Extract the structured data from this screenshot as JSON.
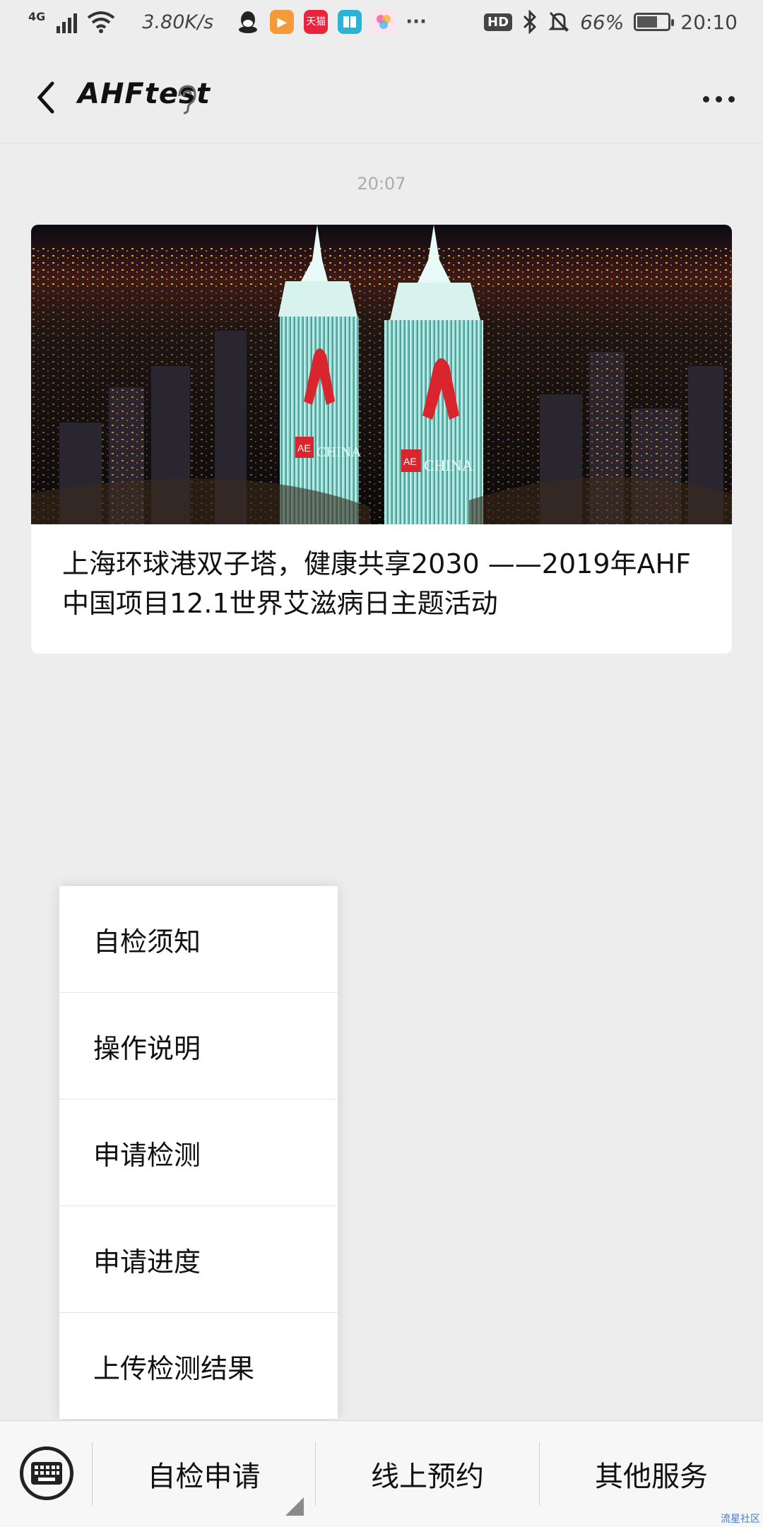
{
  "status_bar": {
    "network_type": "4G",
    "speed": "3.80K/s",
    "more_indicator": "···",
    "hd_label": "HD",
    "battery_percent": "66%",
    "battery_level": 0.66,
    "time": "20:10",
    "app_icons": [
      {
        "name": "qq-icon",
        "color": "#222222"
      },
      {
        "name": "video-app-icon",
        "color": "#f29b38"
      },
      {
        "name": "tmall-icon",
        "color": "#e8253c",
        "label": "天猫"
      },
      {
        "name": "reader-app-icon",
        "color": "#2bb3d6"
      },
      {
        "name": "gallery-app-icon",
        "color": "#f07ab0"
      }
    ]
  },
  "header": {
    "title": "AHFtest",
    "back_icon": "chevron-left-icon",
    "ear_icon": "ear-icon",
    "more_icon": "more-dots-icon"
  },
  "chat": {
    "timestamp": "20:07",
    "article": {
      "title": "上海环球港双子塔，健康共享2030 ——2019年AHF中国项目12.1世界艾滋病日主题活动",
      "image_overlay": [
        "AE",
        "CHINA"
      ]
    }
  },
  "popup_menu": {
    "items": [
      "自检须知",
      "操作说明",
      "申请检测",
      "申请进度",
      "上传检测结果"
    ]
  },
  "bottom_menu": {
    "keyboard_icon": "keyboard-icon",
    "items": [
      "自检申请",
      "线上预约",
      "其他服务"
    ]
  },
  "watermark": "流星社区",
  "colors": {
    "background": "#ededed",
    "card": "#ffffff",
    "ribbon": "#d9262e",
    "tower_glow": "#9fe8e0"
  }
}
